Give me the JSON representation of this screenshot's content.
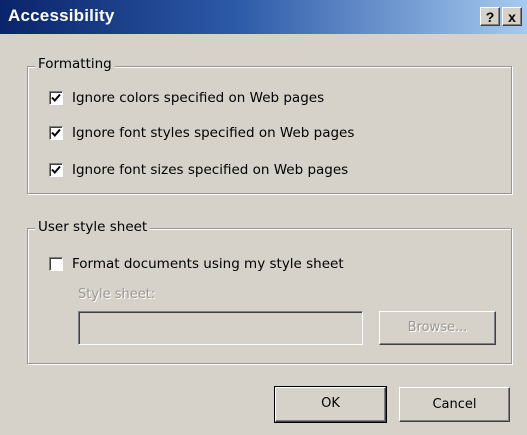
{
  "window": {
    "title": "Accessibility",
    "help_label": "?",
    "close_label": "x"
  },
  "formatting": {
    "legend": "Formatting",
    "options": [
      {
        "label": "Ignore colors specified on Web pages",
        "checked": true
      },
      {
        "label": "Ignore font styles specified on Web pages",
        "checked": true
      },
      {
        "label": "Ignore font sizes specified on Web pages",
        "checked": true
      }
    ]
  },
  "user_style": {
    "legend": "User style sheet",
    "format_option": {
      "label": "Format documents using my style sheet",
      "checked": false
    },
    "style_sheet_label": "Style sheet:",
    "style_sheet_value": "",
    "browse_label": "Browse..."
  },
  "buttons": {
    "ok_label": "OK",
    "cancel_label": "Cancel"
  },
  "colors": {
    "dialog_background": "#d6d2ca",
    "titlebar_start": "#0a246a",
    "titlebar_end": "#a6caf0",
    "disabled_text": "#9c9890"
  },
  "icons": {
    "check": "check-icon",
    "help": "help-icon",
    "close": "close-icon"
  }
}
